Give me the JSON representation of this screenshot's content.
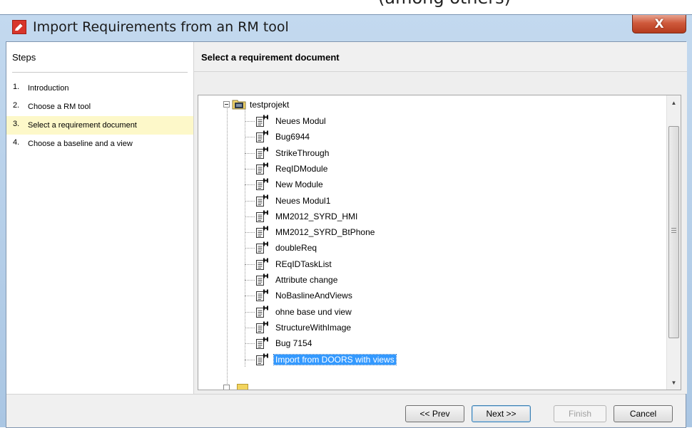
{
  "top_fragment": "(among others)",
  "window": {
    "title": "Import Requirements from an RM tool",
    "close_label": "X"
  },
  "steps": {
    "header": "Steps",
    "items": [
      {
        "num": "1.",
        "label": "Introduction",
        "active": false
      },
      {
        "num": "2.",
        "label": "Choose a RM tool",
        "active": false
      },
      {
        "num": "3.",
        "label": "Select a requirement document",
        "active": true
      },
      {
        "num": "4.",
        "label": "Choose a baseline and a view",
        "active": false
      }
    ]
  },
  "main": {
    "title": "Select a requirement document",
    "tree": {
      "root_label": "testprojekt",
      "root_icon": "folder-open-icon",
      "item_icon": "document-icon",
      "items": [
        {
          "label": "Neues Modul",
          "selected": false
        },
        {
          "label": "Bug6944",
          "selected": false
        },
        {
          "label": "StrikeThrough",
          "selected": false
        },
        {
          "label": "ReqIDModule",
          "selected": false
        },
        {
          "label": "New Module",
          "selected": false
        },
        {
          "label": "Neues Modul1",
          "selected": false
        },
        {
          "label": "MM2012_SYRD_HMI",
          "selected": false
        },
        {
          "label": "MM2012_SYRD_BtPhone",
          "selected": false
        },
        {
          "label": "doubleReq",
          "selected": false
        },
        {
          "label": "REqIDTaskList",
          "selected": false
        },
        {
          "label": "Attribute change",
          "selected": false
        },
        {
          "label": "NoBaslineAndViews",
          "selected": false
        },
        {
          "label": "ohne base und view",
          "selected": false
        },
        {
          "label": "StructureWithImage",
          "selected": false
        },
        {
          "label": "Bug 7154",
          "selected": false
        },
        {
          "label": "Import from DOORS with views",
          "selected": true
        }
      ]
    },
    "scrollbar": {
      "up_glyph": "▲",
      "down_glyph": "▼"
    }
  },
  "buttons": {
    "prev": "<< Prev",
    "next": "Next >>",
    "finish": "Finish",
    "cancel": "Cancel"
  },
  "colors": {
    "selection": "#3399ff",
    "active_step": "#fdf8c9",
    "close_button": "#cf5a3c"
  }
}
